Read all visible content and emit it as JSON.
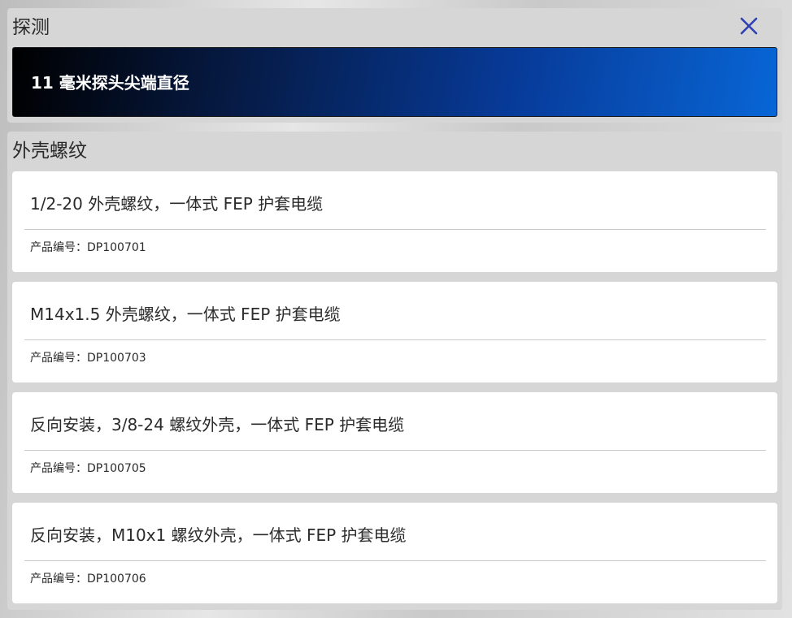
{
  "probe_section": {
    "title": "探测",
    "selected_option": "11 毫米探头尖端直径",
    "close_icon": "close-icon",
    "close_color": "#2f3fb0"
  },
  "thread_section": {
    "title": "外壳螺纹",
    "part_number_label": "产品编号：",
    "items": [
      {
        "title": "1/2-20 外壳螺纹，一体式 FEP 护套电缆",
        "part_number": "产品编号：DP100701"
      },
      {
        "title": "M14x1.5 外壳螺纹，一体式 FEP 护套电缆",
        "part_number": "产品编号：DP100703"
      },
      {
        "title": "反向安装，3/8-24 螺纹外壳，一体式 FEP 护套电缆",
        "part_number": "产品编号：DP100705"
      },
      {
        "title": "反向安装，M10x1 螺纹外壳，一体式 FEP 护套电缆",
        "part_number": "产品编号：DP100706"
      }
    ]
  },
  "colors": {
    "selected_gradient_start": "#000000",
    "selected_gradient_end": "#0866d6",
    "panel_background": "#d6d6d6",
    "card_background": "#ffffff"
  }
}
